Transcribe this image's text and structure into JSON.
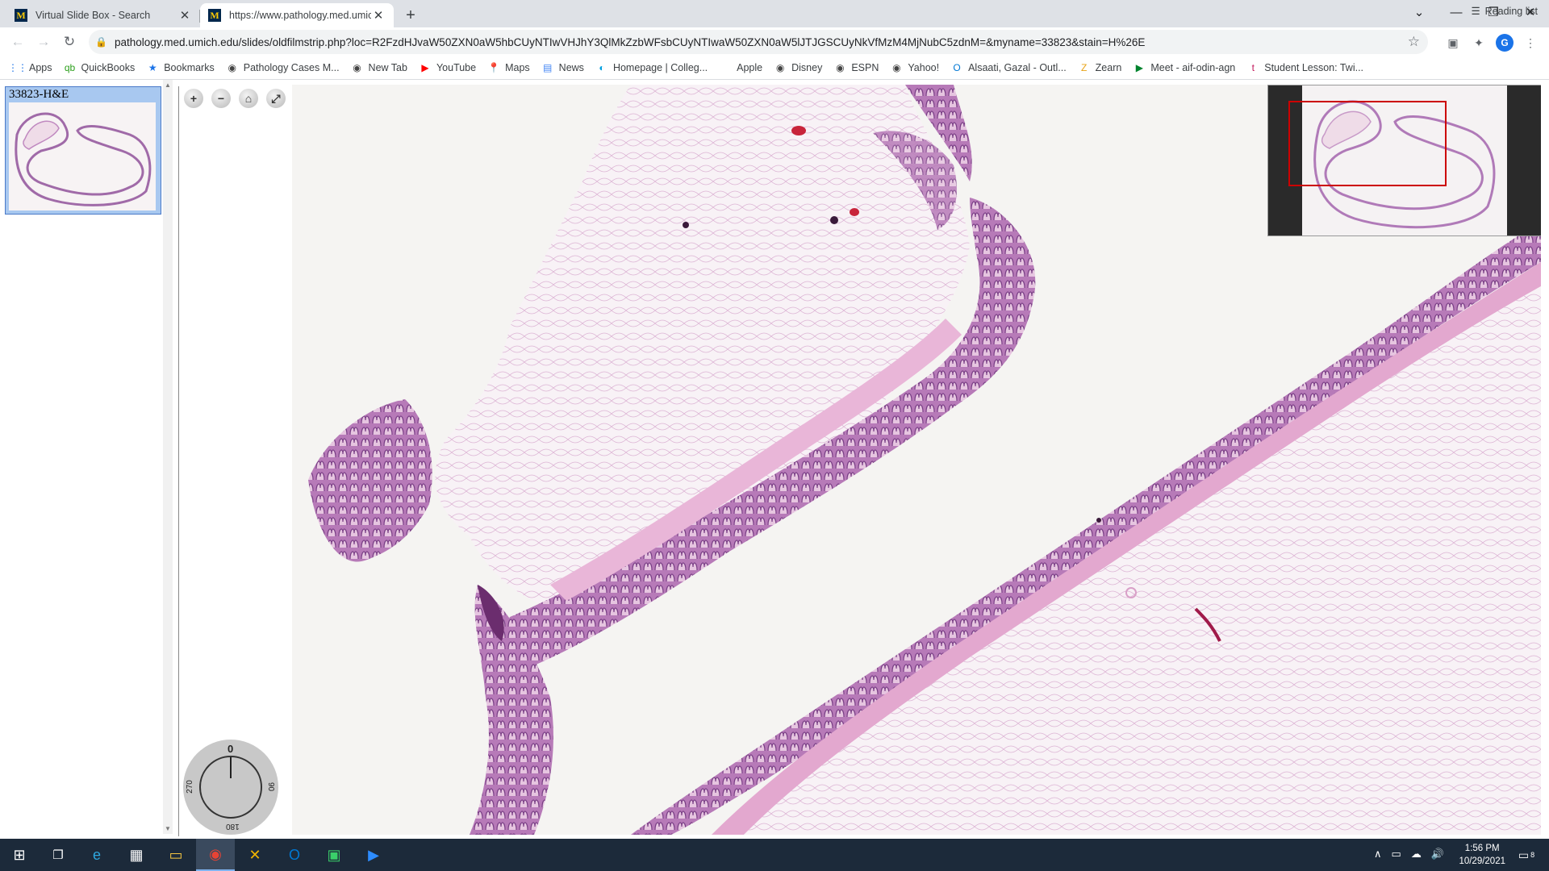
{
  "tabs": [
    {
      "title": "Virtual Slide Box - Search",
      "favicon": "umich-logo"
    },
    {
      "title": "https://www.pathology.med.umich.edu/slides/oldfilmstrip.php",
      "favicon": "umich-logo"
    }
  ],
  "favicon_letter": "M",
  "new_tab_symbol": "+",
  "window_controls": {
    "dropdown": "⌄",
    "minimize": "—",
    "maximize": "❐",
    "close": "✕"
  },
  "toolbar": {
    "back": "←",
    "forward": "→",
    "reload": "↻",
    "lock": "🔒",
    "url": "pathology.med.umich.edu/slides/oldfilmstrip.php?loc=R2FzdHJvaW50ZXN0aW5hbCUyNTIwVHJhY3QlMkZzbWFsbCUyNTIwaW50ZXN0aW5lJTJGSCUyNkVfMzM4MjNubC5zdnM=&myname=33823&stain=H%26E",
    "star": "☆",
    "profile_initial": "G",
    "menu": "⋮"
  },
  "bookmarks": [
    {
      "label": "Apps",
      "icon": "apps-grid-icon",
      "glyph": "⋮⋮",
      "color": "#1a73e8"
    },
    {
      "label": "QuickBooks",
      "icon": "quickbooks-icon",
      "glyph": "qb",
      "color": "#2ca01c"
    },
    {
      "label": "Bookmarks",
      "icon": "star-icon",
      "glyph": "★",
      "color": "#1a73e8"
    },
    {
      "label": "Pathology Cases M...",
      "icon": "globe-icon",
      "glyph": "◉",
      "color": "#444"
    },
    {
      "label": "New Tab",
      "icon": "globe-icon",
      "glyph": "◉",
      "color": "#444"
    },
    {
      "label": "YouTube",
      "icon": "youtube-icon",
      "glyph": "▶",
      "color": "#ff0000"
    },
    {
      "label": "Maps",
      "icon": "maps-pin-icon",
      "glyph": "📍",
      "color": "#34a853"
    },
    {
      "label": "News",
      "icon": "news-icon",
      "glyph": "▤",
      "color": "#4285f4"
    },
    {
      "label": "Homepage | Colleg...",
      "icon": "college-icon",
      "glyph": "◐",
      "color": "#00a0e0"
    },
    {
      "label": "Apple",
      "icon": "apple-icon",
      "glyph": "",
      "color": "#555"
    },
    {
      "label": "Disney",
      "icon": "disney-icon",
      "glyph": "◉",
      "color": "#444"
    },
    {
      "label": "ESPN",
      "icon": "globe-icon",
      "glyph": "◉",
      "color": "#444"
    },
    {
      "label": "Yahoo!",
      "icon": "globe-icon",
      "glyph": "◉",
      "color": "#444"
    },
    {
      "label": "Alsaati, Gazal - Outl...",
      "icon": "outlook-icon",
      "glyph": "O",
      "color": "#0078d4"
    },
    {
      "label": "Zearn",
      "icon": "zearn-icon",
      "glyph": "Z",
      "color": "#e8a317"
    },
    {
      "label": "Meet - aif-odin-agn",
      "icon": "meet-icon",
      "glyph": "▶",
      "color": "#00832d"
    },
    {
      "label": "Student Lesson: Twi...",
      "icon": "lesson-icon",
      "glyph": "t",
      "color": "#c2185b"
    }
  ],
  "reading_list": {
    "label": "Reading list",
    "glyph": "☰"
  },
  "filmstrip": {
    "slides": [
      {
        "label": "33823-H&E"
      }
    ],
    "scroll_up": "▲",
    "scroll_down": "▼"
  },
  "viewer_tools": [
    {
      "name": "zoom-in-button",
      "glyph": "+"
    },
    {
      "name": "zoom-out-button",
      "glyph": "−"
    },
    {
      "name": "home-button",
      "glyph": "⌂"
    },
    {
      "name": "fullscreen-button",
      "glyph": "⤢"
    },
    {
      "name": "screenshot-button",
      "glyph": "◙"
    }
  ],
  "rotation": {
    "top": "0",
    "right": "90",
    "bottom": "180",
    "left": "270",
    "angle_deg": 0
  },
  "taskbar": {
    "start": "⊞",
    "task_view": "❐",
    "apps": [
      {
        "name": "edge-icon",
        "glyph": "e",
        "color": "#2ea8e0"
      },
      {
        "name": "store-icon",
        "glyph": "▦",
        "color": "#fff"
      },
      {
        "name": "file-explorer-icon",
        "glyph": "▭",
        "color": "#f4c542"
      },
      {
        "name": "chrome-icon",
        "glyph": "◉",
        "color": "#e84335",
        "active": true
      },
      {
        "name": "app-icon",
        "glyph": "✕",
        "color": "#f0b400"
      },
      {
        "name": "outlook-icon",
        "glyph": "O",
        "color": "#0078d4"
      },
      {
        "name": "photos-icon",
        "glyph": "▣",
        "color": "#3ad06a"
      },
      {
        "name": "zoom-icon",
        "glyph": "▶",
        "color": "#2d8cff"
      }
    ],
    "tray": {
      "chevron": "∧",
      "network": "▭",
      "cloud": "☁",
      "volume": "🔊"
    },
    "time": "1:56 PM",
    "date": "10/29/2021",
    "notifications": "8"
  },
  "colors": {
    "tissue_pink": "#d98fc0",
    "tissue_purple": "#8a4a8e",
    "minimap_box": "#cc0000"
  }
}
